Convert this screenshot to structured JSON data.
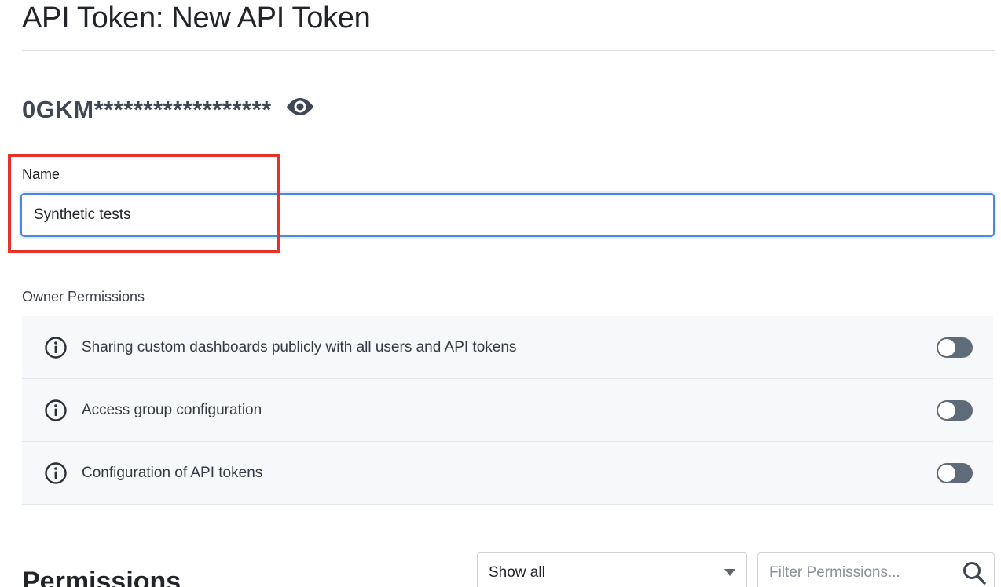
{
  "header": {
    "title": "API Token: New API Token"
  },
  "token": {
    "masked_value": "0GKM******************",
    "reveal_icon": "eye-icon"
  },
  "name_field": {
    "label": "Name",
    "value": "Synthetic tests",
    "highlighted": true,
    "highlight_color": "#e5322d",
    "focus_color": "#4a86e8"
  },
  "owner_permissions": {
    "label": "Owner Permissions",
    "items": [
      {
        "label": "Sharing custom dashboards publicly with all users and API tokens",
        "icon": "info-icon",
        "enabled": false
      },
      {
        "label": "Access group configuration",
        "icon": "info-icon",
        "enabled": false
      },
      {
        "label": "Configuration of API tokens",
        "icon": "info-icon",
        "enabled": false
      }
    ]
  },
  "permissions": {
    "heading": "Permissions",
    "filter_select": {
      "selected": "Show all"
    },
    "filter_input": {
      "placeholder": "Filter Permissions...",
      "value": ""
    }
  }
}
